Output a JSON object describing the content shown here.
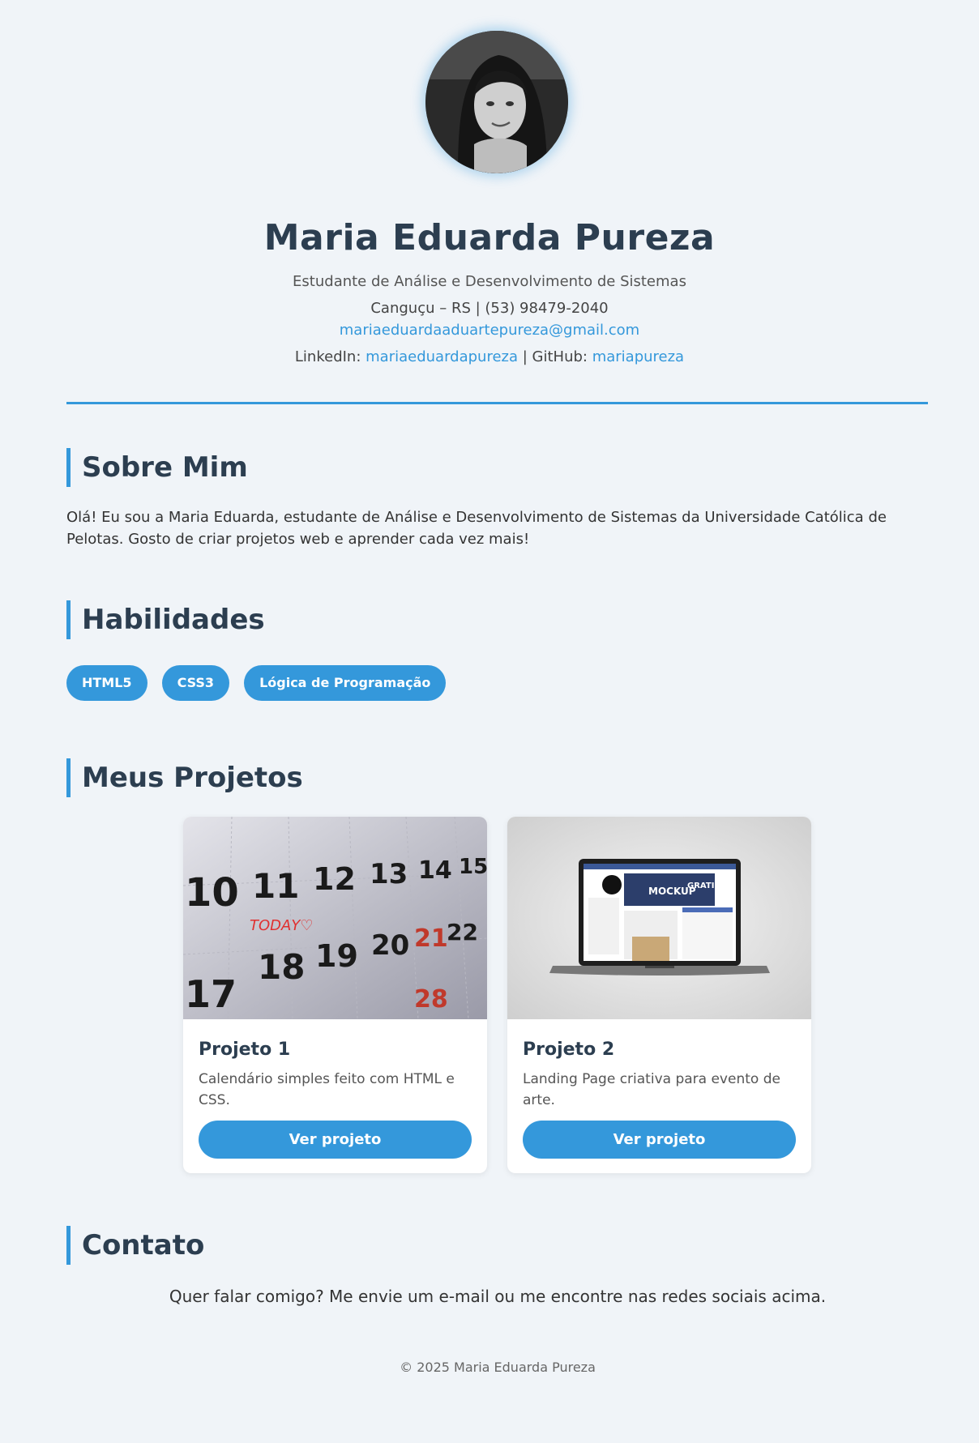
{
  "header": {
    "name": "Maria Eduarda Pureza",
    "subtitle": "Estudante de Análise e Desenvolvimento de Sistemas",
    "location": "Canguçu – RS | (53) 98479-2040",
    "email": "mariaeduardaaduartepureza@gmail.com",
    "linkedin_label": "LinkedIn: ",
    "linkedin_link": "mariaeduardapureza",
    "separator": " | ",
    "github_label": "GitHub: ",
    "github_link": "mariapureza"
  },
  "about": {
    "title": "Sobre Mim",
    "text": "Olá! Eu sou a Maria Eduarda, estudante de Análise e Desenvolvimento de Sistemas da Universidade Católica de Pelotas. Gosto de criar projetos web e aprender cada vez mais!"
  },
  "skills": {
    "title": "Habilidades",
    "items": [
      "HTML5",
      "CSS3",
      "Lógica de Programação"
    ]
  },
  "projects": {
    "title": "Meus Projetos",
    "items": [
      {
        "title": "Projeto 1",
        "description": "Calendário simples feito com HTML e CSS.",
        "button": "Ver projeto"
      },
      {
        "title": "Projeto 2",
        "description": "Landing Page criativa para evento de arte.",
        "button": "Ver projeto"
      }
    ]
  },
  "contact": {
    "title": "Contato",
    "text": "Quer falar comigo? Me envie um e-mail ou me encontre nas redes sociais acima."
  },
  "footer": {
    "text": "© 2025 Maria Eduarda Pureza"
  },
  "colors": {
    "accent": "#3498db",
    "background": "#f0f4f8",
    "heading": "#2c3e50"
  }
}
